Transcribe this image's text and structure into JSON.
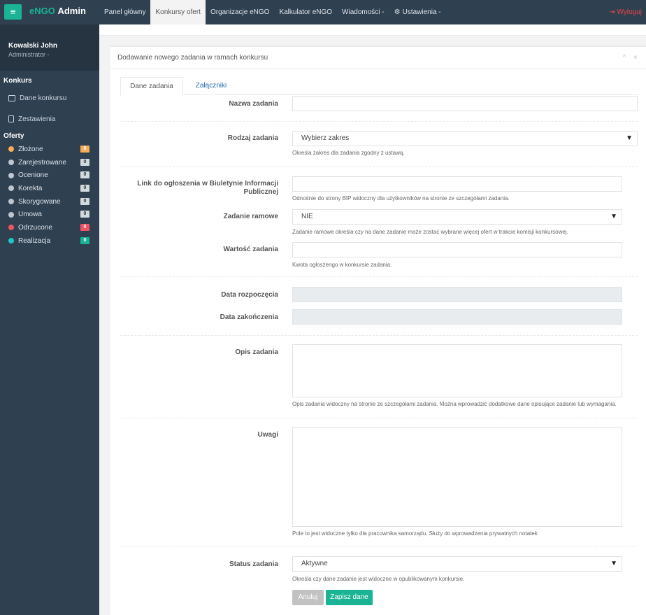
{
  "app": {
    "brand_main": "eNGO",
    "brand_bold": "Admin",
    "menu_glyph": "≡"
  },
  "nav": [
    {
      "label": "Panel główny"
    },
    {
      "label": "Konkursy ofert"
    },
    {
      "label": "Organizacje eNGO"
    },
    {
      "label": "Kalkulator eNGO"
    },
    {
      "label": "Wiadomości -"
    },
    {
      "label": "Ustawienia -"
    }
  ],
  "logout": {
    "icon": "⇥",
    "label": "Wyloguj"
  },
  "profile": {
    "name": "Kowalski John",
    "role": "Administrator -"
  },
  "sidebar": {
    "section_konkurs": "Konkurs",
    "links": [
      {
        "label": "Dane konkursu"
      },
      {
        "label": "Zestawienia"
      }
    ],
    "section_oferty": "Oferty",
    "statuses": [
      {
        "label": "Złożone",
        "count": "0",
        "color": "#f8ac59",
        "badge": "#f8ac59"
      },
      {
        "label": "Zarejestrowane",
        "count": "0",
        "color": "#bfc6cf",
        "badge": "#d1dade"
      },
      {
        "label": "Ocenione",
        "count": "0",
        "color": "#bfc6cf",
        "badge": "#d1dade"
      },
      {
        "label": "Korekta",
        "count": "0",
        "color": "#bfc6cf",
        "badge": "#d1dade"
      },
      {
        "label": "Skorygowane",
        "count": "0",
        "color": "#bfc6cf",
        "badge": "#d1dade"
      },
      {
        "label": "Umowa",
        "count": "0",
        "color": "#bfc6cf",
        "badge": "#d1dade"
      },
      {
        "label": "Odrzucone",
        "count": "0",
        "color": "#ed5565",
        "badge": "#ed5565"
      },
      {
        "label": "Realizacja",
        "count": "0",
        "color": "#23c6c8",
        "badge": "#1ab394"
      }
    ]
  },
  "panel": {
    "title": "Dodawanie nowego zadania w ramach konkursu",
    "tools": "^ ×",
    "tabs": [
      {
        "label": "Dane zadania"
      },
      {
        "label": "Załączniki"
      }
    ]
  },
  "form": {
    "nazwa": {
      "label": "Nazwa zadania",
      "value": ""
    },
    "rodzaj": {
      "label": "Rodzaj zadania",
      "value": "Wybierz zakres",
      "help": "Określa zakres dla zadania zgodny z ustawą."
    },
    "link": {
      "label": "Link do ogłoszenia w Biuletynie Informacji Publicznej",
      "value": "",
      "help": "Odnośnie do strony BIP widoczny dla użytkowników na stronie ze szczegółami zadania."
    },
    "ramowe": {
      "label": "Zadanie ramowe",
      "value": "NIE",
      "help": "Zadanie ramowe określa czy na dane zadanie może zostać wybrane więcej ofert w trakcie komisji konkursowej."
    },
    "wartosc": {
      "label": "Wartość zadania",
      "value": "",
      "help": "Kwota ogłoszengo w konkursie zadania."
    },
    "data_start": {
      "label": "Data rozpoczęcia",
      "value": ""
    },
    "data_end": {
      "label": "Data zakończenia",
      "value": ""
    },
    "opis": {
      "label": "Opis zadania",
      "value": "",
      "help": "Opis zadania widoczny na stronie ze szczegółami zadania. Można wprowadzić dodatkowe dane opisujące zadanie lub wymagania."
    },
    "uwagi": {
      "label": "Uwagi",
      "value": "",
      "help": "Pole to jest widoczne tylko dla pracownika samorządu. Służy do wprowadzenia prywatnych notatek"
    },
    "status": {
      "label": "Status zadania",
      "value": "Aktywne",
      "help": "Określa czy dane zadanie jest widoczne w opublikowanym konkursie."
    },
    "select_arrow": "▼"
  },
  "buttons": {
    "cancel": "Anuluj",
    "save": "Zapisz dane"
  }
}
